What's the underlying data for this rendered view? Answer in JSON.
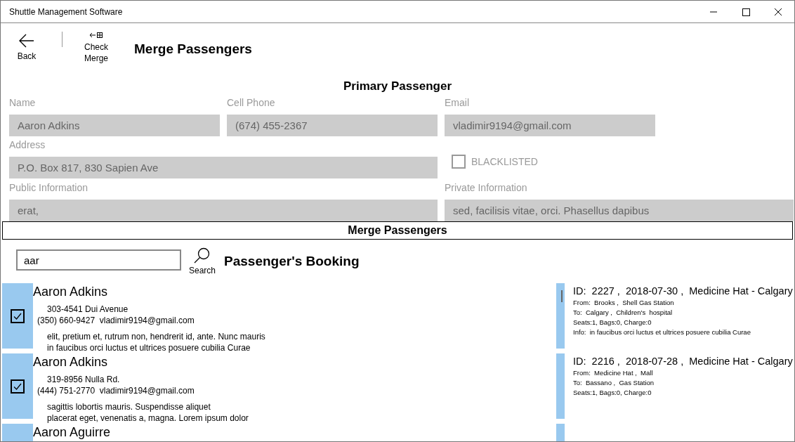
{
  "window": {
    "title": "Shuttle Management Software"
  },
  "toolbar": {
    "buttons": [
      {
        "kind": "back",
        "label": "Back"
      },
      {
        "kind": "merge",
        "label": "Check Merge"
      }
    ],
    "title": "Merge Passengers"
  },
  "primary": {
    "heading": "Primary Passenger",
    "fields": [
      {
        "label": "Name",
        "value": "Aaron Adkins",
        "disabled": true
      },
      {
        "label": "Cell Phone",
        "value": "(674) 455-2367",
        "disabled": true
      },
      {
        "label": "Email",
        "value": "vladimir9194@gmail.com",
        "disabled": true
      },
      {
        "label": "Address",
        "value": "P.O. Box 817, 830 Sapien Ave",
        "disabled": true
      },
      {
        "label": "Public Information",
        "value": "erat,",
        "disabled": true
      },
      {
        "label": "Private Information",
        "value": "sed, facilisis vitae, orci. Phasellus dapibus",
        "disabled": true
      }
    ],
    "blacklisted": {
      "label": "BLACKLISTED",
      "checked": false
    }
  },
  "merge": {
    "heading": "Merge Passengers",
    "search": {
      "value": "aar",
      "button": "Search"
    },
    "bookings_heading": "Passenger's Booking"
  },
  "passengers": [
    {
      "name": "Aaron Adkins",
      "address": "303-4541 Dui Avenue",
      "phone": "(350) 660-9427",
      "email": "vladimir9194@gmail.com",
      "notes": [
        "elit, pretium et, rutrum non, hendrerit id, ante. Nunc mauris",
        "in faucibus orci luctus et ultrices posuere cubilia Curae"
      ],
      "checked": true
    },
    {
      "name": "Aaron Adkins",
      "address": "319-8956 Nulla Rd.",
      "phone": "(444) 751-2770",
      "email": "vladimir9194@gmail.com",
      "notes": [
        "sagittis lobortis mauris. Suspendisse aliquet",
        "placerat eget, venenatis a, magna. Lorem ipsum dolor"
      ],
      "checked": true
    },
    {
      "name": "Aaron Aguirre"
    }
  ],
  "bookings": [
    {
      "header": "ID:  2227 ,  2018-07-30 ,  Medicine Hat - Calgary",
      "lines": [
        "From:  Brooks ,  Shell Gas Station",
        "To:  Calgary ,  Children's  hospital",
        "Seats:1, Bags:0, Charge:0",
        "Info:  in faucibus orci luctus et ultrices posuere cubilia Curae"
      ]
    },
    {
      "header": "ID:  2216 ,  2018-07-28 ,  Medicine Hat - Calgary",
      "lines": [
        "From:  Medicine Hat ,  Mall",
        "To:  Bassano ,  Gas Station",
        "Seats:1, Bags:0, Charge:0"
      ]
    }
  ]
}
